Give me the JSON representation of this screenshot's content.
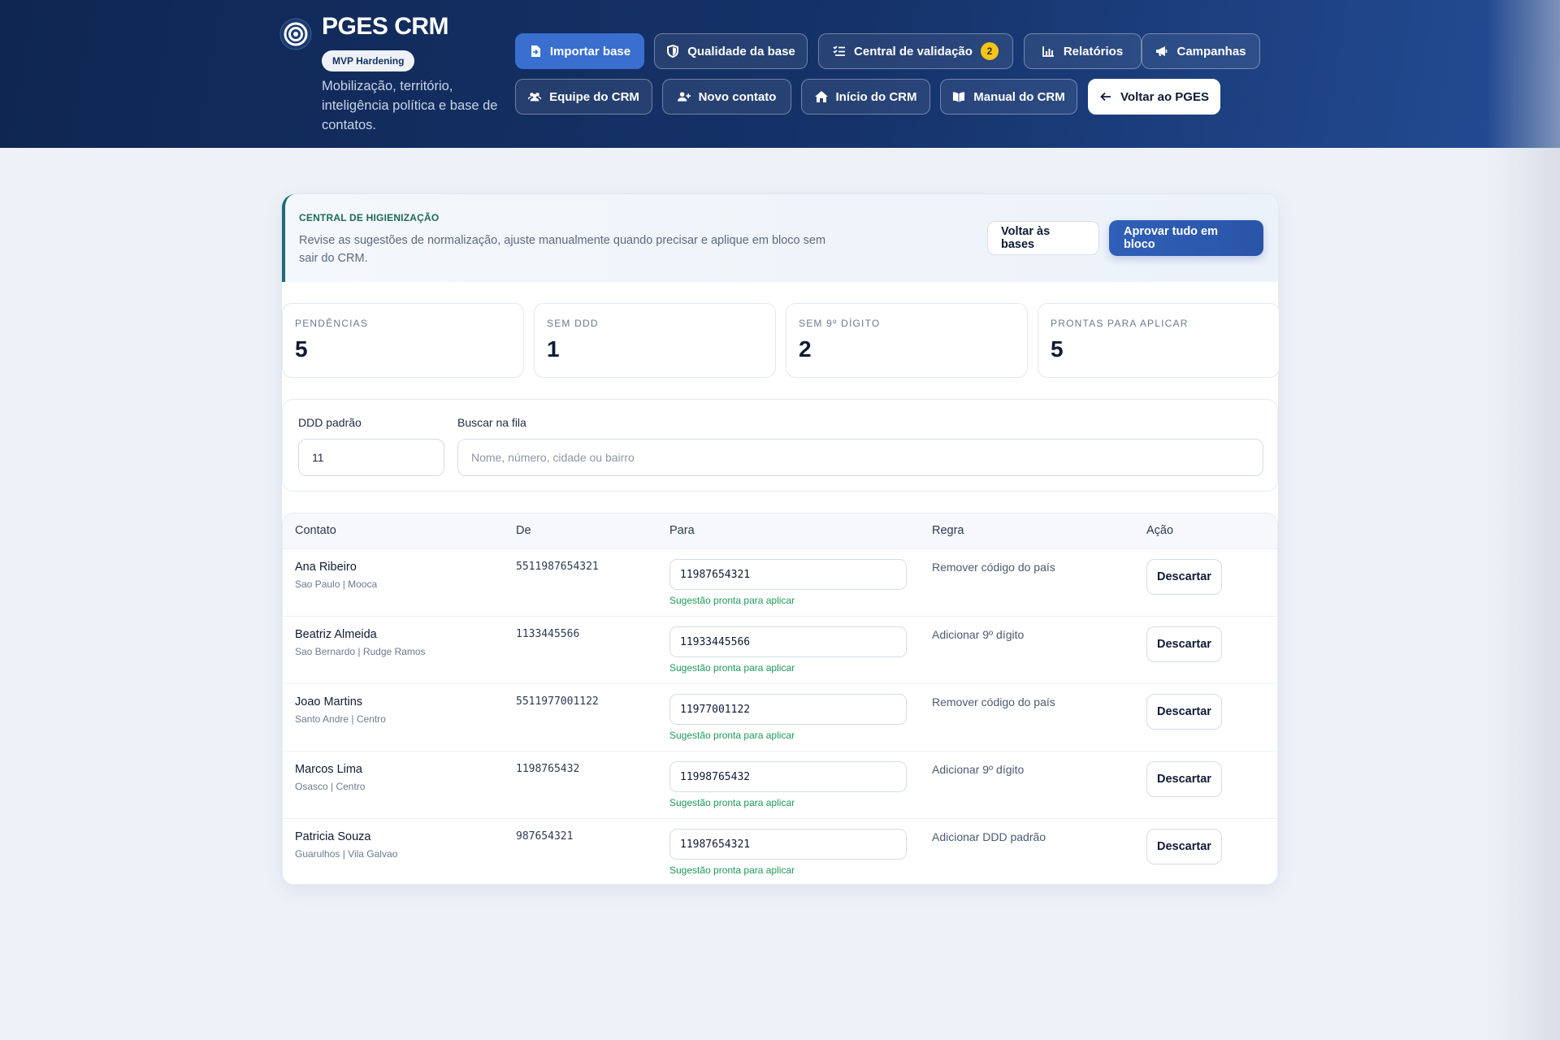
{
  "brand": {
    "title": "PGES CRM",
    "badge": "MVP Hardening",
    "description": "Mobilização, território, inteligência política e base de contatos.",
    "logo_icon": "target-icon"
  },
  "nav": {
    "row1": [
      {
        "label": "Importar base",
        "icon": "file-import-icon",
        "style": "primary"
      },
      {
        "label": "Qualidade da base",
        "icon": "shield-icon",
        "style": "outline"
      },
      {
        "label": "Central de validação",
        "icon": "checklist-icon",
        "style": "outline",
        "badge": "2"
      },
      {
        "label": "Relatórios",
        "icon": "bar-chart-icon",
        "style": "outline"
      },
      {
        "label": "Campanhas",
        "icon": "megaphone-icon",
        "style": "outline"
      }
    ],
    "row2": [
      {
        "label": "Equipe do CRM",
        "icon": "users-icon",
        "style": "outline"
      },
      {
        "label": "Novo contato",
        "icon": "user-plus-icon",
        "style": "outline"
      },
      {
        "label": "Início do CRM",
        "icon": "home-icon",
        "style": "outline"
      },
      {
        "label": "Manual do CRM",
        "icon": "book-icon",
        "style": "outline"
      },
      {
        "label": "Voltar ao PGES",
        "icon": "arrow-left-icon",
        "style": "light"
      }
    ]
  },
  "hero": {
    "kicker": "CENTRAL DE HIGIENIZAÇÃO",
    "text": "Revise as sugestões de normalização, ajuste manualmente quando precisar e aplique em bloco sem sair do CRM.",
    "back_label": "Voltar às bases",
    "approve_label": "Aprovar tudo em bloco"
  },
  "stats": [
    {
      "label": "PENDÊNCIAS",
      "value": "5"
    },
    {
      "label": "SEM DDD",
      "value": "1"
    },
    {
      "label": "SEM 9º DÍGITO",
      "value": "2"
    },
    {
      "label": "PRONTAS PARA APLICAR",
      "value": "5"
    }
  ],
  "filters": {
    "ddd_label": "DDD padrão",
    "ddd_value": "11",
    "search_label": "Buscar na fila",
    "search_placeholder": "Nome, número, cidade ou bairro"
  },
  "table": {
    "headers": [
      "Contato",
      "De",
      "Para",
      "Regra",
      "Ação"
    ],
    "rows": [
      {
        "name": "Ana Ribeiro",
        "location": "Sao Paulo | Mooca",
        "from": "5511987654321",
        "to": "11987654321",
        "hint": "Sugestão pronta para aplicar",
        "rule": "Remover código do país",
        "action": "Descartar"
      },
      {
        "name": "Beatriz Almeida",
        "location": "Sao Bernardo | Rudge Ramos",
        "from": "1133445566",
        "to": "11933445566",
        "hint": "Sugestão pronta para aplicar",
        "rule": "Adicionar 9º dígito",
        "action": "Descartar"
      },
      {
        "name": "Joao Martins",
        "location": "Santo Andre | Centro",
        "from": "5511977001122",
        "to": "11977001122",
        "hint": "Sugestão pronta para aplicar",
        "rule": "Remover código do país",
        "action": "Descartar"
      },
      {
        "name": "Marcos Lima",
        "location": "Osasco | Centro",
        "from": "1198765432",
        "to": "11998765432",
        "hint": "Sugestão pronta para aplicar",
        "rule": "Adicionar 9º dígito",
        "action": "Descartar"
      },
      {
        "name": "Patricia Souza",
        "location": "Guarulhos | Vila Galvao",
        "from": "987654321",
        "to": "11987654321",
        "hint": "Sugestão pronta para aplicar",
        "rule": "Adicionar DDD padrão",
        "action": "Descartar"
      }
    ]
  },
  "colors": {
    "header_start": "#0f2652",
    "header_end": "#244c95",
    "primary": "#2f5fb8",
    "success_text": "#1f9a5b",
    "badge_yellow": "#f5c518"
  }
}
